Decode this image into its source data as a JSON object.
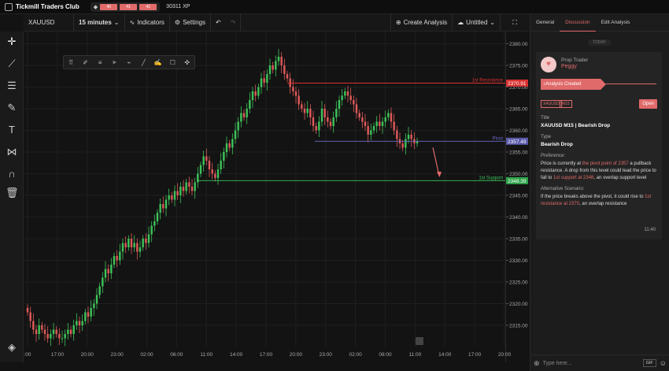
{
  "topbar": {
    "brand": "Tickmill Traders Club",
    "xp_levels": [
      "40",
      "41",
      "42"
    ],
    "xp_points": "30311 XP"
  },
  "toolbar": {
    "symbol": "XAUUSD",
    "interval": "15 minutes",
    "indicators": "Indicators",
    "settings": "Settings",
    "create_analysis": "Create Analysis",
    "layout_name": "Untitled"
  },
  "chart_data": {
    "type": "candlestick",
    "symbol": "XAUUSD",
    "interval": "15 minutes",
    "ylim": [
      2311,
      2381
    ],
    "y_ticks": [
      "2380.00",
      "2375.00",
      "2370.00",
      "2365.00",
      "2360.00",
      "2355.00",
      "2350.00",
      "2345.00",
      "2340.00",
      "2335.00",
      "2330.00",
      "2325.00",
      "2320.00",
      "2315.00"
    ],
    "x_ticks": [
      ":00",
      "17:00",
      "20:00",
      "23:00",
      "02:00",
      "08:00",
      "11:00",
      "14:00",
      "17:00",
      "20:00",
      "23:00",
      "02:00",
      "08:00",
      "11:00",
      "14:00",
      "17:00",
      "20:00"
    ],
    "levels": [
      {
        "name": "1st Resistance",
        "price": 2370.91,
        "label": "2370.91",
        "color": "#e03030"
      },
      {
        "name": "Pivot",
        "price": 2357.49,
        "label": "2357.49",
        "color": "#6a6acc"
      },
      {
        "name": "1st Support",
        "price": 2348.39,
        "label": "2348.39",
        "color": "#3ec45a"
      }
    ],
    "closes": [
      2318,
      2316,
      2314,
      2313,
      2315,
      2314,
      2313,
      2312,
      2313,
      2314,
      2313,
      2312,
      2312,
      2313,
      2314,
      2313,
      2315,
      2316,
      2315,
      2316,
      2318,
      2317,
      2319,
      2320,
      2322,
      2324,
      2326,
      2328,
      2327,
      2329,
      2331,
      2330,
      2332,
      2334,
      2333,
      2335,
      2333,
      2334,
      2332,
      2333,
      2335,
      2334,
      2336,
      2338,
      2339,
      2341,
      2343,
      2342,
      2344,
      2345,
      2344,
      2346,
      2345,
      2347,
      2346,
      2348,
      2347,
      2346,
      2348,
      2350,
      2352,
      2354,
      2353,
      2351,
      2350,
      2349,
      2351,
      2353,
      2355,
      2357,
      2356,
      2358,
      2360,
      2362,
      2364,
      2363,
      2365,
      2367,
      2369,
      2368,
      2370,
      2372,
      2371,
      2373,
      2375,
      2374,
      2376,
      2377,
      2375,
      2373,
      2372,
      2370,
      2369,
      2368,
      2366,
      2365,
      2364,
      2365,
      2363,
      2361,
      2360,
      2362,
      2365,
      2363,
      2362,
      2361,
      2363,
      2365,
      2367,
      2368,
      2369,
      2368,
      2367,
      2366,
      2364,
      2363,
      2362,
      2361,
      2359,
      2360,
      2361,
      2362,
      2361,
      2362,
      2363,
      2364,
      2362,
      2360,
      2358,
      2357,
      2356,
      2358,
      2359,
      2358,
      2357,
      2357.5
    ],
    "forecast": {
      "from": 2357.5,
      "to": 2349
    }
  },
  "drawing_tools": [
    "drag-handle-icon",
    "pencil-icon",
    "lines-icon",
    "fib-icon",
    "path-icon",
    "ruler-icon",
    "brush-icon",
    "rectangle-icon",
    "crosshair-icon"
  ],
  "panel": {
    "tabs": [
      "General",
      "Discussion",
      "Edit Analysis"
    ],
    "active_tab": "Discussion",
    "today": "TODAY",
    "author_role": "Prop Trader",
    "author_name": "Peggy",
    "created_label": "Analysis Created",
    "badges": [
      "XAUUSD",
      "M15"
    ],
    "open_label": "Open",
    "title_label": "Title",
    "title_value": "XAUUSD M15 | Bearish Drop",
    "type_label": "Type",
    "type_value": "Bearish Drop",
    "pref_label": "Preference:",
    "pref_1": "Price is currently at ",
    "pref_2": "the pivot point of 2357",
    "pref_3": " a pullback resistance. A drop from this level could lead the price to fall to ",
    "pref_4": "1st support at 2348",
    "pref_5": ", an overlap support level",
    "alt_label": "Alternative Scenario:",
    "alt_1": " If the price breaks above the pivot, it could rise to ",
    "alt_2": "1st resistance at 2370",
    "alt_3": ", an overlap resistance",
    "time": "11:40",
    "message_placeholder": "Type here...",
    "gif_label": "GIF"
  }
}
